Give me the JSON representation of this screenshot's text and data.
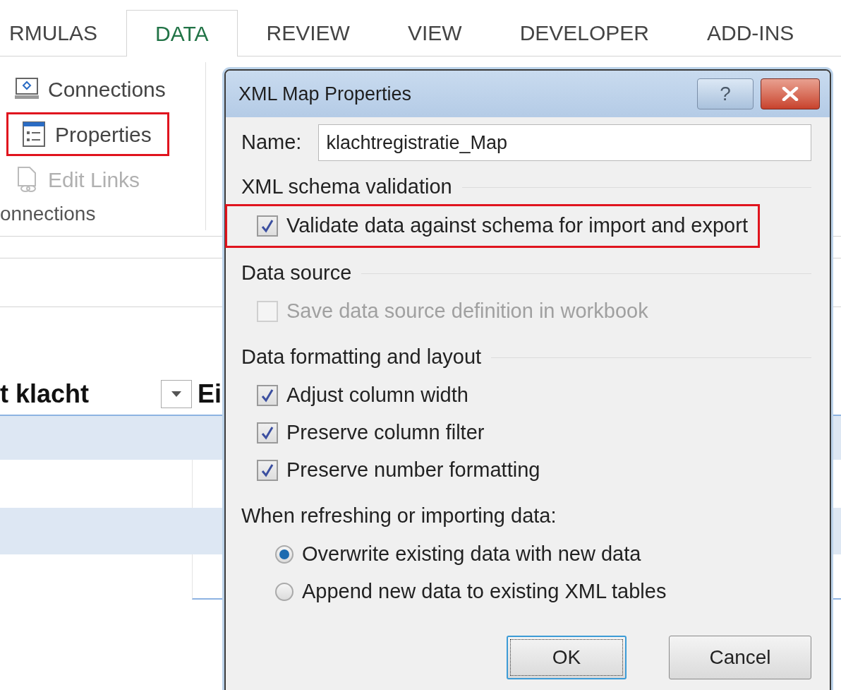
{
  "ribbon_tabs": [
    {
      "label": "RMULAS",
      "selected": false
    },
    {
      "label": "DATA",
      "selected": true
    },
    {
      "label": "REVIEW",
      "selected": false
    },
    {
      "label": "VIEW",
      "selected": false
    },
    {
      "label": "DEVELOPER",
      "selected": false
    },
    {
      "label": "ADD-INS",
      "selected": false
    }
  ],
  "connections_group": {
    "items": [
      {
        "kind": "connections",
        "label": "Connections",
        "disabled": false,
        "highlighted": false
      },
      {
        "kind": "properties",
        "label": "Properties",
        "disabled": false,
        "highlighted": true
      },
      {
        "kind": "edit_links",
        "label": "Edit Links",
        "disabled": true,
        "highlighted": false
      }
    ],
    "group_label": "onnections"
  },
  "table": {
    "columns": [
      {
        "label": "t klacht",
        "filter_button": true
      },
      {
        "label": "Ei",
        "filter_button": false
      }
    ]
  },
  "dialog": {
    "title": "XML Map Properties",
    "help_button": "?",
    "name_field": {
      "label": "Name:",
      "value": "klachtregistratie_Map"
    },
    "sections": [
      {
        "kind": "checkboxes",
        "title": "XML schema validation",
        "options": [
          {
            "label": "Validate data against schema for import and export",
            "checked": true,
            "disabled": false,
            "highlighted": true
          }
        ]
      },
      {
        "kind": "checkboxes",
        "title": "Data source",
        "options": [
          {
            "label": "Save data source definition in workbook",
            "checked": false,
            "disabled": true,
            "highlighted": false
          }
        ]
      },
      {
        "kind": "checkboxes",
        "title": "Data formatting and layout",
        "options": [
          {
            "label": "Adjust column width",
            "checked": true,
            "disabled": false,
            "highlighted": false
          },
          {
            "label": "Preserve column filter",
            "checked": true,
            "disabled": false,
            "highlighted": false
          },
          {
            "label": "Preserve number formatting",
            "checked": true,
            "disabled": false,
            "highlighted": false
          }
        ]
      },
      {
        "kind": "radios",
        "title": "When refreshing or importing data:",
        "options": [
          {
            "label": "Overwrite existing data with new data",
            "selected": true
          },
          {
            "label": "Append new data to existing XML tables",
            "selected": false
          }
        ]
      }
    ],
    "buttons": [
      {
        "label": "OK",
        "default": true
      },
      {
        "label": "Cancel",
        "default": false
      }
    ]
  }
}
